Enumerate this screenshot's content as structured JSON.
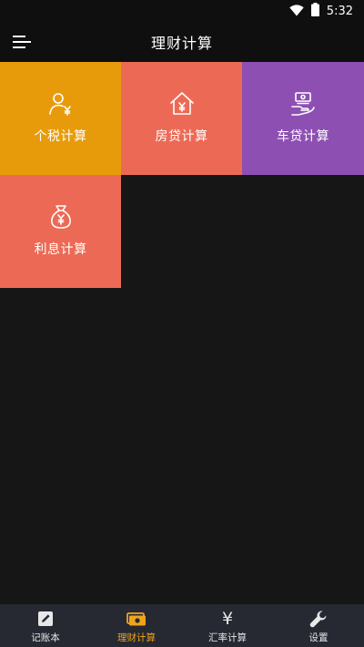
{
  "status_bar": {
    "time": "5:32"
  },
  "app_bar": {
    "title": "理财计算"
  },
  "tiles": [
    {
      "label": "个税计算",
      "color": "#e89b0a",
      "icon": "user-yen-icon"
    },
    {
      "label": "房贷计算",
      "color": "#ec6a55",
      "icon": "house-yen-icon"
    },
    {
      "label": "车贷计算",
      "color": "#8e4fb3",
      "icon": "car-loan-icon"
    },
    {
      "label": "利息计算",
      "color": "#ec6a55",
      "icon": "money-bag-icon"
    }
  ],
  "bottom_nav": {
    "items": [
      {
        "label": "记账本",
        "icon": "notebook-pen-icon",
        "active": false
      },
      {
        "label": "理财计算",
        "icon": "cash-icon",
        "active": true
      },
      {
        "label": "汇率计算",
        "icon": "yen-icon",
        "glyph": "¥",
        "active": false
      },
      {
        "label": "设置",
        "icon": "wrench-icon",
        "active": false
      }
    ],
    "active_color": "#f0a31c"
  }
}
